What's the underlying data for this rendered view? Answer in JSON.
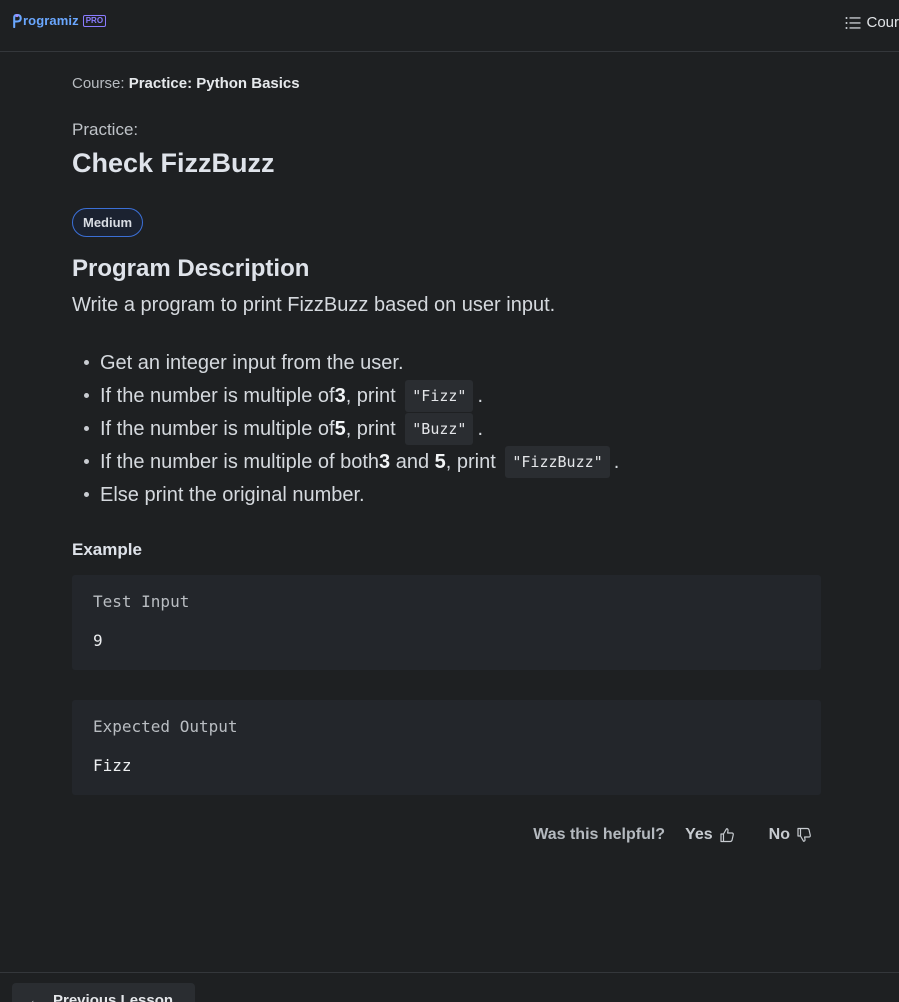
{
  "header": {
    "logo_text": "rogramiz",
    "logo_badge": "PRO",
    "courses_label": "Cour"
  },
  "breadcrumb": {
    "prefix": "Course:",
    "course_name": "Practice: Python Basics"
  },
  "practice_label": "Practice:",
  "title": "Check FizzBuzz",
  "difficulty": "Medium",
  "description": {
    "heading": "Program Description",
    "text": "Write a program to print FizzBuzz based on user input.",
    "bullets": [
      {
        "before": "Get an integer input from the user."
      },
      {
        "before": "If the number is multiple of ",
        "bold1": "3",
        "mid": ", print",
        "code": "\"Fizz\"",
        "after": "."
      },
      {
        "before": "If the number is multiple of ",
        "bold1": "5",
        "mid": ", print",
        "code": "\"Buzz\"",
        "after": "."
      },
      {
        "before": "If the number is multiple of both ",
        "bold1": "3",
        "and": " and ",
        "bold2": "5",
        "mid": ", print",
        "code": "\"FizzBuzz\"",
        "after": "."
      },
      {
        "before": "Else print the original number."
      }
    ]
  },
  "example": {
    "heading": "Example",
    "test_input_label": "Test Input",
    "test_input_value": "9",
    "expected_output_label": "Expected Output",
    "expected_output_value": "Fizz"
  },
  "feedback": {
    "question": "Was this helpful?",
    "yes": "Yes",
    "no": "No"
  },
  "footer": {
    "previous_label": "Previous Lesson"
  },
  "colors": {
    "background": "#1e2022",
    "accent_blue": "#3b6fd6",
    "logo_blue": "#6aa7ff",
    "pro_purple": "#8a7cff"
  }
}
